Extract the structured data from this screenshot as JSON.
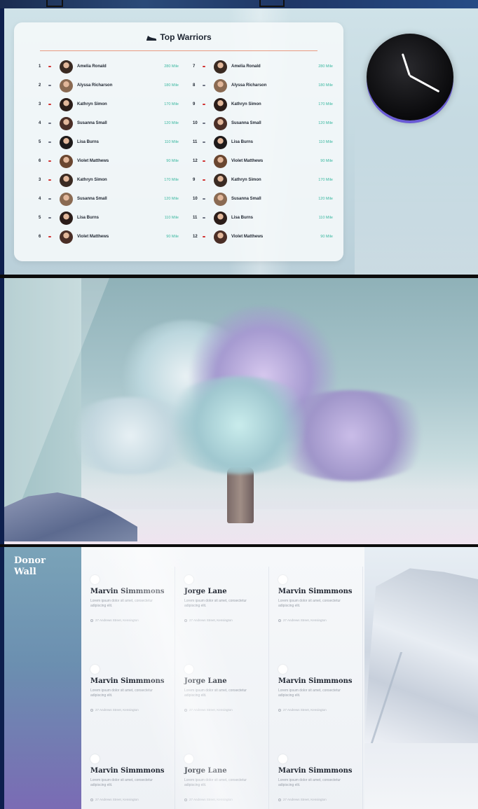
{
  "leaderboard": {
    "title": "Top Warriors",
    "rows": [
      {
        "rank": "1",
        "name": "Amelia Ronald",
        "miles": "280 Mile",
        "trend": "up"
      },
      {
        "rank": "2",
        "name": "Alyssa Richarson",
        "miles": "180 Mile",
        "trend": "down"
      },
      {
        "rank": "3",
        "name": "Kathryn Simon",
        "miles": "170 Mile",
        "trend": "up"
      },
      {
        "rank": "4",
        "name": "Susanna Small",
        "miles": "120 Mile",
        "trend": "down"
      },
      {
        "rank": "5",
        "name": "Lisa Burns",
        "miles": "110 Mile",
        "trend": "down"
      },
      {
        "rank": "6",
        "name": "Violet Matthews",
        "miles": "90 Mile",
        "trend": "up"
      },
      {
        "rank": "3",
        "name": "Kathryn Simon",
        "miles": "170 Mile",
        "trend": "up"
      },
      {
        "rank": "4",
        "name": "Susanna Small",
        "miles": "120 Mile",
        "trend": "down"
      },
      {
        "rank": "5",
        "name": "Lisa Burns",
        "miles": "110 Mile",
        "trend": "down"
      },
      {
        "rank": "6",
        "name": "Violet Matthews",
        "miles": "90 Mile",
        "trend": "up"
      },
      {
        "rank": "7",
        "name": "Amelia Ronald",
        "miles": "280 Mile",
        "trend": "up"
      },
      {
        "rank": "8",
        "name": "Alyssa Richarson",
        "miles": "180 Mile",
        "trend": "down"
      },
      {
        "rank": "9",
        "name": "Kathryn Simon",
        "miles": "170 Mile",
        "trend": "up"
      },
      {
        "rank": "10",
        "name": "Susanna Small",
        "miles": "120 Mile",
        "trend": "down"
      },
      {
        "rank": "11",
        "name": "Lisa Burns",
        "miles": "110 Mile",
        "trend": "down"
      },
      {
        "rank": "12",
        "name": "Violet Matthews",
        "miles": "90 Mile",
        "trend": "up"
      },
      {
        "rank": "9",
        "name": "Kathryn Simon",
        "miles": "170 Mile",
        "trend": "up"
      },
      {
        "rank": "10",
        "name": "Susanna Small",
        "miles": "120 Mile",
        "trend": "down"
      },
      {
        "rank": "11",
        "name": "Lisa Burns",
        "miles": "110 Mile",
        "trend": "down"
      },
      {
        "rank": "12",
        "name": "Violet Matthews",
        "miles": "90 Mile",
        "trend": "up"
      }
    ]
  },
  "clock": {
    "hour": 3,
    "minute": 57
  },
  "donor_wall": {
    "title_line1": "Donor",
    "title_line2": "Wall",
    "donors": [
      {
        "name": "Marvin Simmmons",
        "desc": "Lorem ipsum dolor sit amet, consectetur adipiscing elit.",
        "address": "27 Andrews Street, Kensington"
      },
      {
        "name": "Jorge Lane",
        "desc": "Lorem ipsum dolor sit amet, consectetur adipiscing elit.",
        "address": "27 Andrews Street, Kensington"
      },
      {
        "name": "Marvin Simmmons",
        "desc": "Lorem ipsum dolor sit amet, consectetur adipiscing elit.",
        "address": "27 Andrews Street, Kensington"
      },
      {
        "name": "Marvin Simmmons",
        "desc": "Lorem ipsum dolor sit amet, consectetur adipiscing elit.",
        "address": "27 Andrews Street, Kensington"
      },
      {
        "name": "Jorge Lane",
        "desc": "Lorem ipsum dolor sit amet, consectetur adipiscing elit.",
        "address": "27 Andrews Street, Kensington"
      },
      {
        "name": "Marvin Simmmons",
        "desc": "Lorem ipsum dolor sit amet, consectetur adipiscing elit.",
        "address": "27 Andrews Street, Kensington"
      },
      {
        "name": "Marvin Simmmons",
        "desc": "Lorem ipsum dolor sit amet, consectetur adipiscing elit.",
        "address": "27 Andrews Street, Kensington"
      },
      {
        "name": "Jorge Lane",
        "desc": "Lorem ipsum dolor sit amet, consectetur adipiscing elit.",
        "address": "27 Andrews Street, Kensington"
      },
      {
        "name": "Marvin Simmmons",
        "desc": "Lorem ipsum dolor sit amet, consectetur adipiscing elit.",
        "address": "27 Andrews Street, Kensington"
      }
    ]
  },
  "colors": {
    "accent_mile": "#3bb8a0",
    "trend_up": "#d03030",
    "trend_down": "#6a7080",
    "clock_ring": "#6a5bd6"
  }
}
